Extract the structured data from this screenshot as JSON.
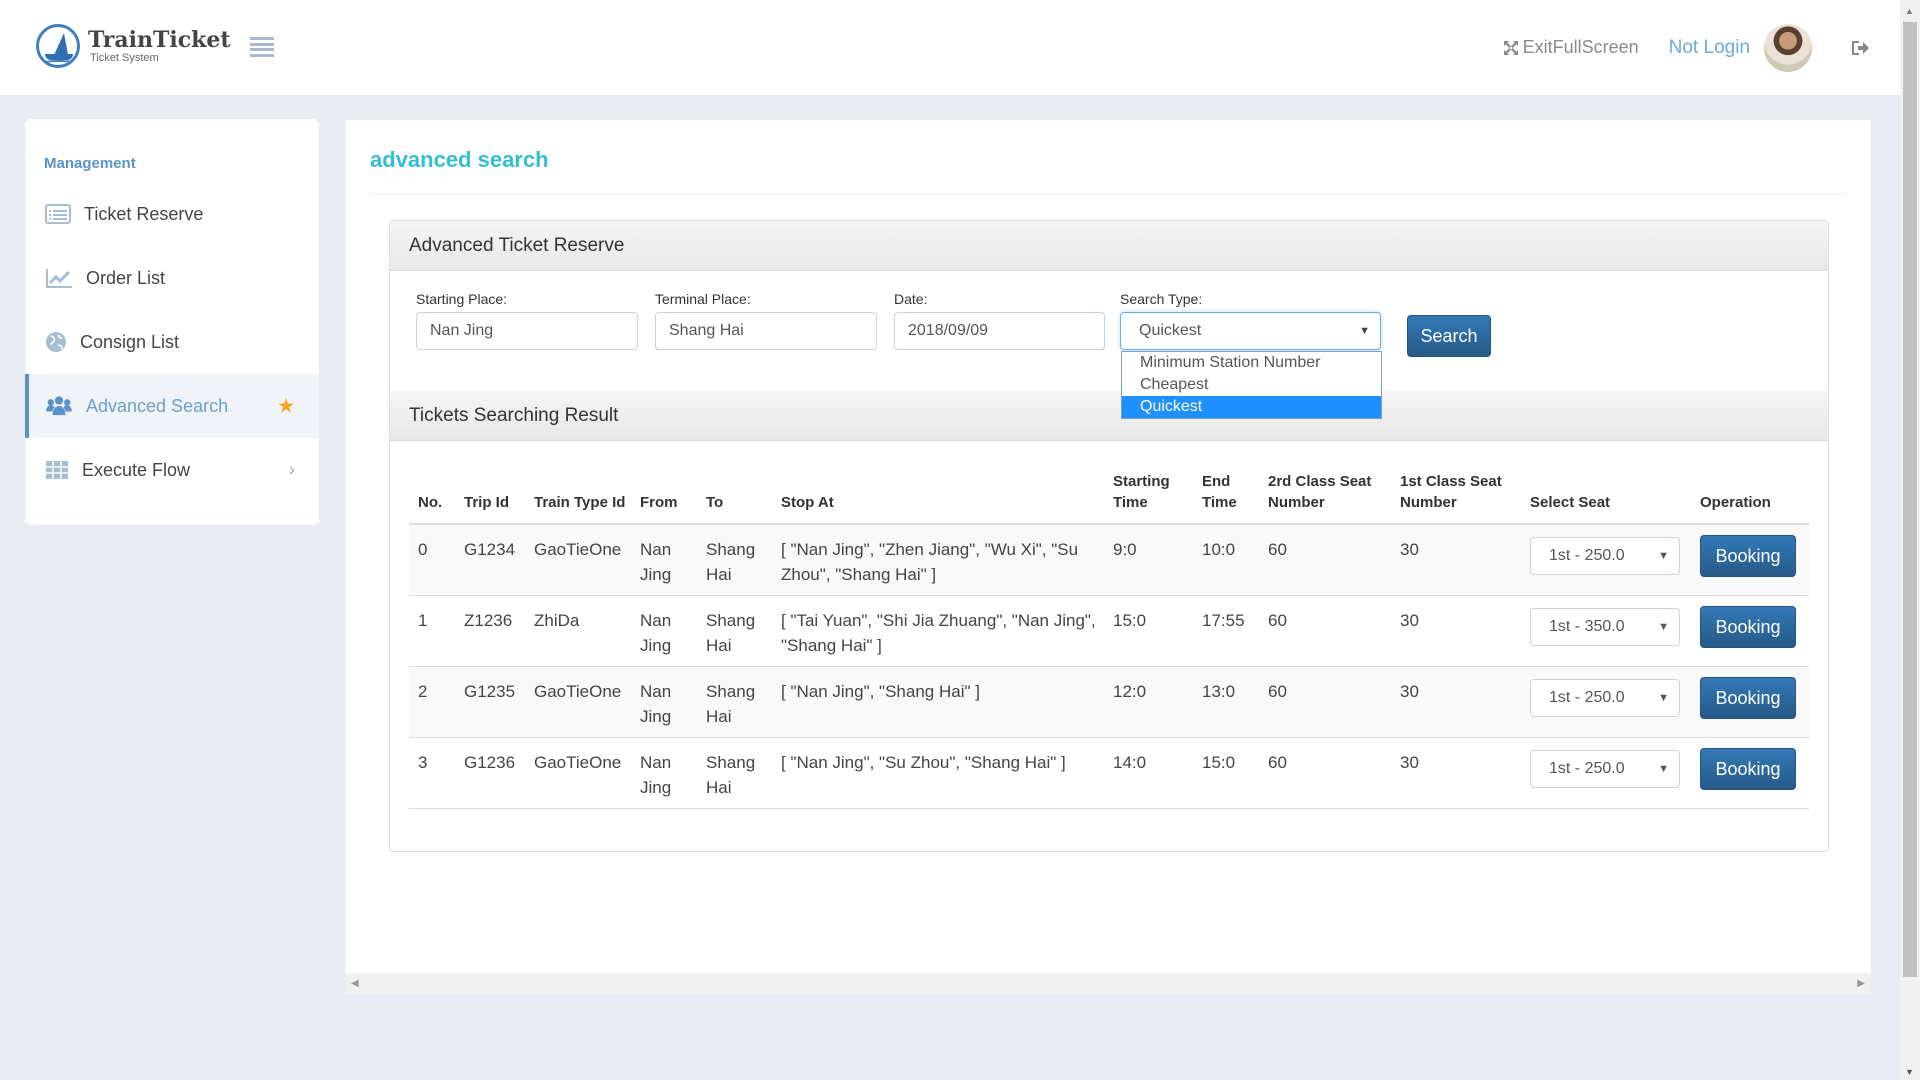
{
  "header": {
    "brand_title": "TrainTicket",
    "brand_subtitle": "Ticket System",
    "fullscreen_label": "ExitFullScreen",
    "login_label": "Not Login"
  },
  "sidebar": {
    "heading": "Management",
    "items": [
      {
        "label": "Ticket Reserve",
        "icon": "list-icon"
      },
      {
        "label": "Order List",
        "icon": "line-chart-icon"
      },
      {
        "label": "Consign List",
        "icon": "globe-icon"
      },
      {
        "label": "Advanced Search",
        "icon": "users-icon",
        "active": true,
        "badge": "star-icon"
      },
      {
        "label": "Execute Flow",
        "icon": "table-icon",
        "badge": "chevron-right-icon"
      }
    ]
  },
  "main": {
    "page_title": "advanced search",
    "reserve_panel": {
      "title": "Advanced Ticket Reserve",
      "starting_place": {
        "label": "Starting Place:",
        "value": "Nan Jing"
      },
      "terminal_place": {
        "label": "Terminal Place:",
        "value": "Shang Hai"
      },
      "date": {
        "label": "Date:",
        "value": "2018/09/09"
      },
      "search_type": {
        "label": "Search Type:",
        "value": "Quickest",
        "options": [
          "Minimum Station Number",
          "Cheapest",
          "Quickest"
        ],
        "highlighted": "Quickest"
      },
      "search_button": "Search"
    },
    "results_panel": {
      "title": "Tickets Searching Result",
      "columns": [
        "No.",
        "Trip Id",
        "Train Type Id",
        "From",
        "To",
        "Stop At",
        "Starting Time",
        "End Time",
        "2rd Class Seat Number",
        "1st Class Seat Number",
        "Select Seat",
        "Operation"
      ],
      "rows": [
        {
          "no": "0",
          "trip_id": "G1234",
          "train_type": "GaoTieOne",
          "from": "Nan Jing",
          "to": "Shang Hai",
          "stop_at": "[ \"Nan Jing\", \"Zhen Jiang\", \"Wu Xi\", \"Su Zhou\", \"Shang Hai\" ]",
          "start": "9:0",
          "end": "10:0",
          "second_class": "60",
          "first_class": "30",
          "seat": "1st - 250.0",
          "operation": "Booking"
        },
        {
          "no": "1",
          "trip_id": "Z1236",
          "train_type": "ZhiDa",
          "from": "Nan Jing",
          "to": "Shang Hai",
          "stop_at": "[ \"Tai Yuan\", \"Shi Jia Zhuang\", \"Nan Jing\", \"Shang Hai\" ]",
          "start": "15:0",
          "end": "17:55",
          "second_class": "60",
          "first_class": "30",
          "seat": "1st - 350.0",
          "operation": "Booking"
        },
        {
          "no": "2",
          "trip_id": "G1235",
          "train_type": "GaoTieOne",
          "from": "Nan Jing",
          "to": "Shang Hai",
          "stop_at": "[ \"Nan Jing\", \"Shang Hai\" ]",
          "start": "12:0",
          "end": "13:0",
          "second_class": "60",
          "first_class": "30",
          "seat": "1st - 250.0",
          "operation": "Booking"
        },
        {
          "no": "3",
          "trip_id": "G1236",
          "train_type": "GaoTieOne",
          "from": "Nan Jing",
          "to": "Shang Hai",
          "stop_at": "[ \"Nan Jing\", \"Su Zhou\", \"Shang Hai\" ]",
          "start": "14:0",
          "end": "15:0",
          "second_class": "60",
          "first_class": "30",
          "seat": "1st - 250.0",
          "operation": "Booking"
        }
      ]
    }
  },
  "colors": {
    "accent_title": "#34bfd0",
    "sidebar_active": "#5b93c9",
    "primary_button": "#286090",
    "dropdown_highlight": "#1e90ff",
    "star": "#f5a623"
  }
}
